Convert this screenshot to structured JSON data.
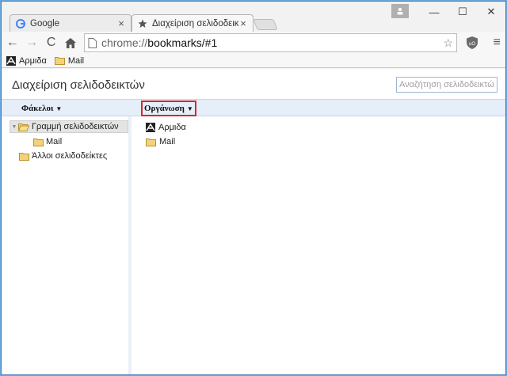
{
  "tabs": [
    {
      "title": "Google",
      "active": false
    },
    {
      "title": "Διαχείριση σελιδοδεικτών",
      "active": true
    }
  ],
  "toolbar": {
    "url_scheme": "chrome://",
    "url_rest": "bookmarks/#1"
  },
  "bookmarks_bar": [
    {
      "label": "Αρμιδα",
      "icon": "armida-favicon"
    },
    {
      "label": "Mail",
      "icon": "folder-icon"
    }
  ],
  "page": {
    "title": "Διαχείριση σελιδοδεικτών",
    "search_placeholder": "Αναζήτηση σελιδοδεικτών",
    "folders_label": "Φάκελοι",
    "organize_label": "Οργάνωση"
  },
  "tree": [
    {
      "label": "Γραμμή σελιδοδεικτών",
      "expanded": true,
      "selected": true
    },
    {
      "label": "Mail",
      "child": true
    },
    {
      "label": "Άλλοι σελιδοδείκτες"
    }
  ],
  "list": [
    {
      "label": "Αρμιδα",
      "icon": "armida-favicon"
    },
    {
      "label": "Mail",
      "icon": "folder-icon"
    }
  ],
  "colors": {
    "accent_border": "#3d7bbf",
    "header_bar": "#e5eef9",
    "highlight_box": "#d9262b",
    "folder": "#e8c46a"
  }
}
